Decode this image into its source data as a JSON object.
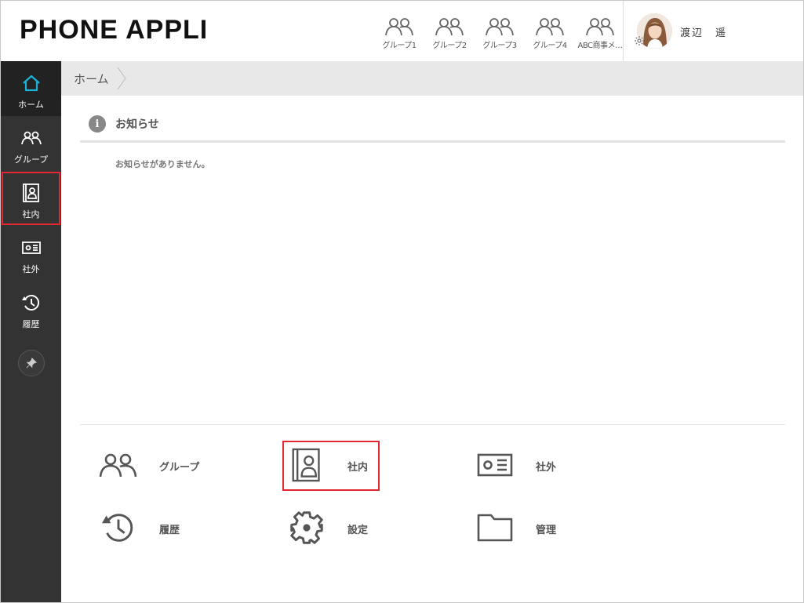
{
  "app": {
    "logo": "PHONE APPLI"
  },
  "header": {
    "groups": [
      {
        "label": "グループ1",
        "icon": "group-icon"
      },
      {
        "label": "グループ2",
        "icon": "group-icon"
      },
      {
        "label": "グループ3",
        "icon": "group-icon"
      },
      {
        "label": "グループ4",
        "icon": "group-icon"
      },
      {
        "label": "ABC商事メ…",
        "icon": "group-icon"
      }
    ],
    "user": {
      "name": "渡辺　遥",
      "avatar": "user-avatar",
      "settings_icon": "gear-icon"
    }
  },
  "sidebar": {
    "items": [
      {
        "label": "ホーム",
        "icon": "home-icon",
        "active": true
      },
      {
        "label": "グループ",
        "icon": "group-icon"
      },
      {
        "label": "社内",
        "icon": "address-book-icon",
        "highlighted": true
      },
      {
        "label": "社外",
        "icon": "id-card-icon"
      },
      {
        "label": "履歴",
        "icon": "history-icon"
      }
    ],
    "pin_icon": "pin-icon"
  },
  "breadcrumb": {
    "current": "ホーム"
  },
  "notice": {
    "title": "お知らせ",
    "empty_message": "お知らせがありません。"
  },
  "shortcuts": [
    {
      "label": "グループ",
      "icon": "group-icon"
    },
    {
      "label": "社内",
      "icon": "address-book-icon",
      "highlighted": true
    },
    {
      "label": "社外",
      "icon": "id-card-icon"
    },
    {
      "label": "履歴",
      "icon": "history-icon"
    },
    {
      "label": "設定",
      "icon": "gear-icon"
    },
    {
      "label": "管理",
      "icon": "folder-icon"
    }
  ],
  "colors": {
    "accent": "#1ab3d6",
    "sidebar": "#333333",
    "highlight": "#e3262f"
  }
}
